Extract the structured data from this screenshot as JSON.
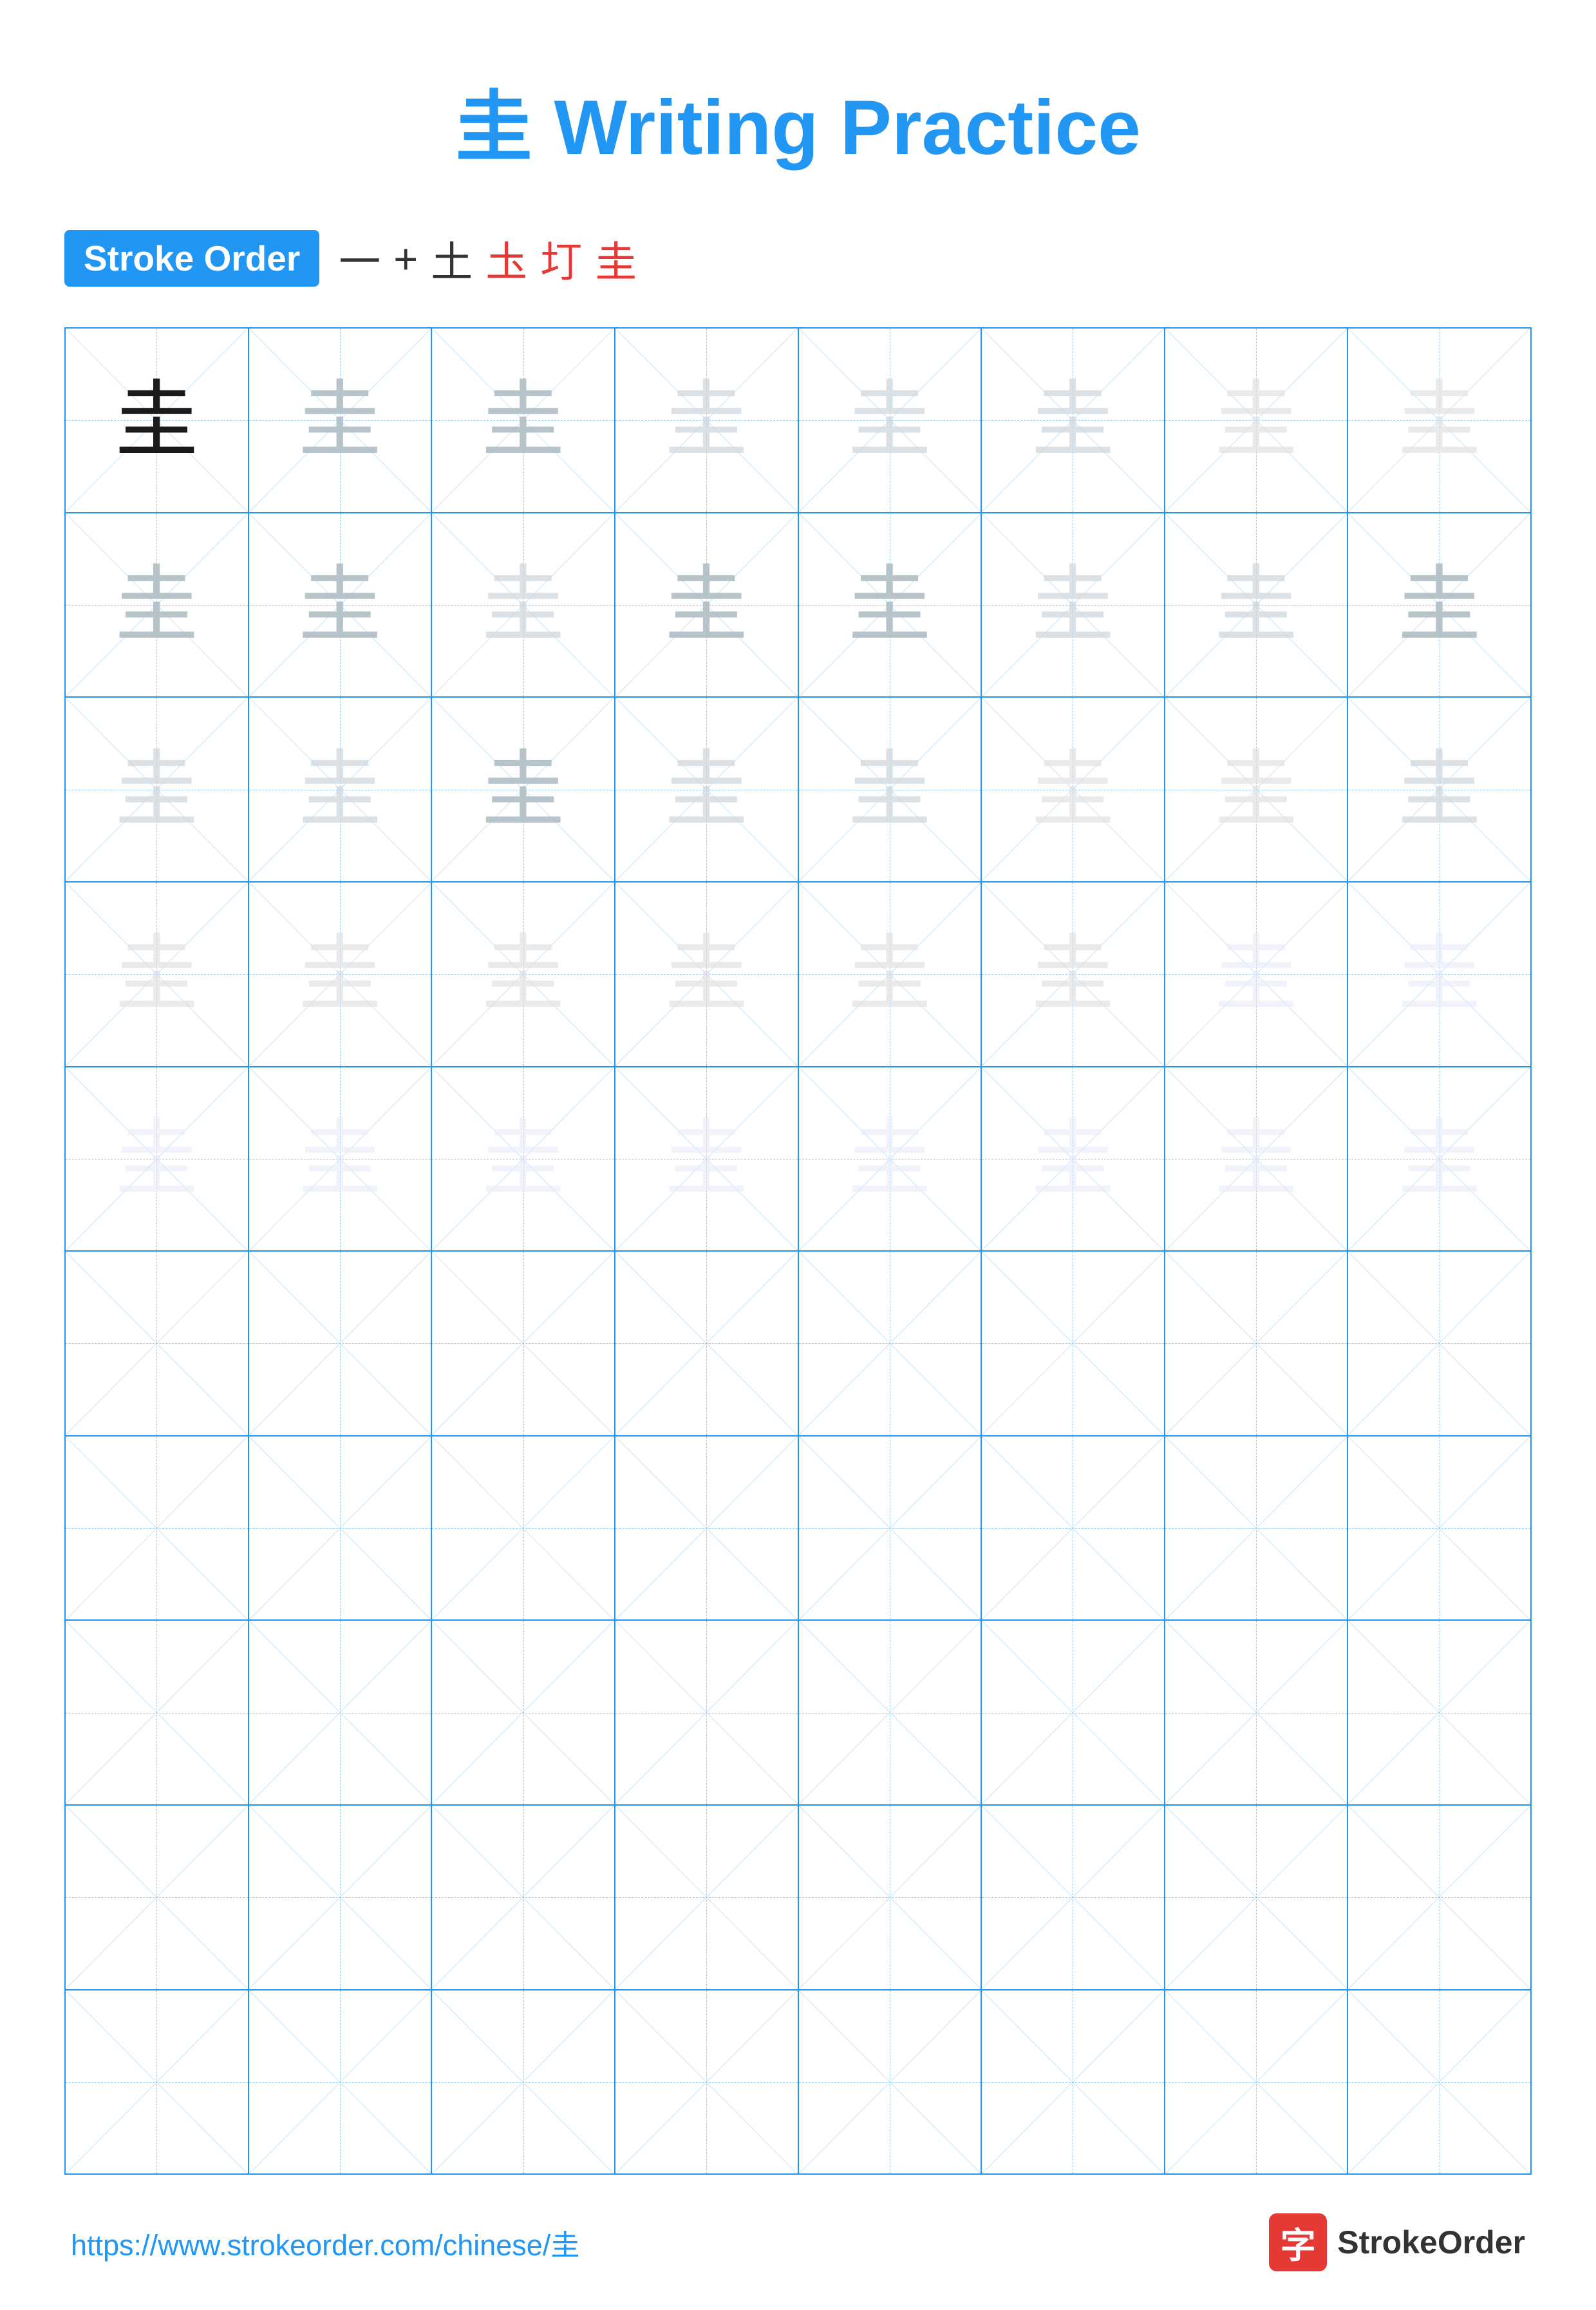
{
  "page": {
    "title": "Writing Practice",
    "char": "圭",
    "title_color": "#2196F3"
  },
  "stroke_order": {
    "badge_label": "Stroke Order",
    "steps": [
      "一",
      "+",
      "土",
      "圡",
      "圢",
      "圭"
    ]
  },
  "grid": {
    "rows": 10,
    "cols": 8,
    "char": "圭",
    "filled_rows": 5
  },
  "footer": {
    "url": "https://www.strokeorder.com/chinese/圭",
    "brand_name": "StrokeOrder",
    "brand_char": "字"
  }
}
